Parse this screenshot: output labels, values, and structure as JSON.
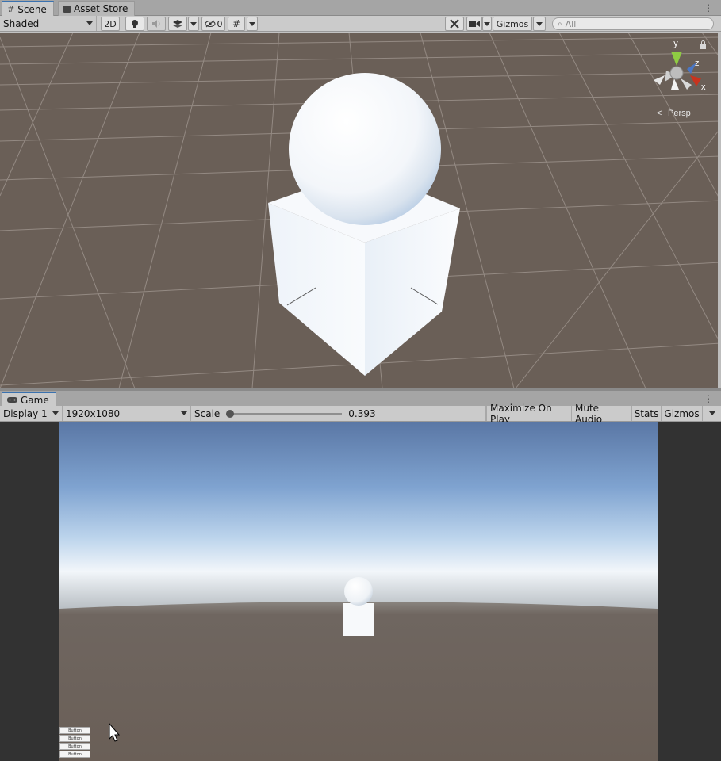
{
  "scene_panel": {
    "tabs": [
      {
        "label": "Scene",
        "icon": "grid-icon"
      },
      {
        "label": "Asset Store",
        "icon": "bag-icon"
      }
    ],
    "toolbar": {
      "draw_mode": "Shaded",
      "btn_2d": "2D",
      "hidden_count": "0",
      "gizmos_label": "Gizmos",
      "search_placeholder": "All"
    },
    "gizmo": {
      "axis_y": "y",
      "axis_z": "z",
      "axis_x": "x",
      "projection": "Persp"
    },
    "colors": {
      "ground": "#6a5f57",
      "grid_line": "#9a928b"
    }
  },
  "game_panel": {
    "tab": {
      "label": "Game",
      "icon": "gamepad-icon"
    },
    "toolbar": {
      "display": "Display 1",
      "resolution": "1920x1080",
      "scale_label": "Scale",
      "scale_value": "0.393",
      "maximize_on_play": "Maximize On Play",
      "mute_audio": "Mute Audio",
      "stats": "Stats",
      "gizmos": "Gizmos"
    },
    "ui_buttons": [
      "Button",
      "Button",
      "Button",
      "Button"
    ],
    "colors": {
      "sky_top": "#5c7aa8",
      "horizon": "#eef3f8",
      "ground": "#6a5f57",
      "letterbox": "#323232"
    }
  }
}
